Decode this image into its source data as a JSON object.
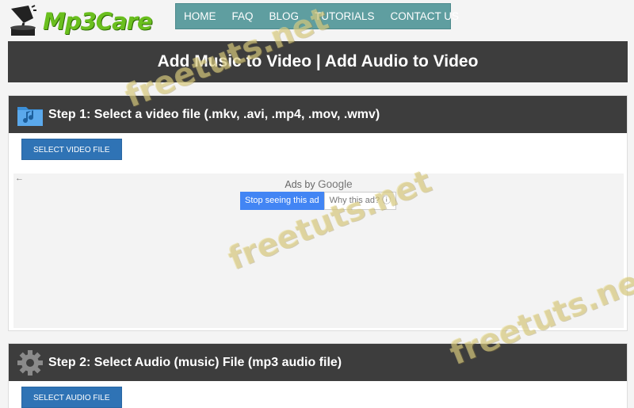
{
  "header": {
    "logo_text": "Mp3Care",
    "nav": [
      "HOME",
      "FAQ",
      "BLOG",
      "TUTORIALS",
      "CONTACT US"
    ]
  },
  "page_title": "Add Music to Video | Add Audio to Video",
  "step1": {
    "title": "Step 1: Select a video file (.mkv, .avi, .mp4, .mov, .wmv)",
    "button": "SELECT VIDEO FILE",
    "icon": "music-folder-icon"
  },
  "ad": {
    "back_arrow": "←",
    "ads_by": "Ads by",
    "google": "Google",
    "stop_label": "Stop seeing this ad",
    "why_label": "Why this ad? ⓘ"
  },
  "step2": {
    "title": "Step 2: Select Audio (music) File (mp3 audio file)",
    "button": "SELECT AUDIO FILE",
    "icon": "gear-icon"
  },
  "watermark": "freetuts.net",
  "colors": {
    "dark_bar": "#3d3d3d",
    "nav_bg": "#5f9ea0",
    "button_blue": "#2f73b5",
    "logo_green": "#6abf1e"
  }
}
